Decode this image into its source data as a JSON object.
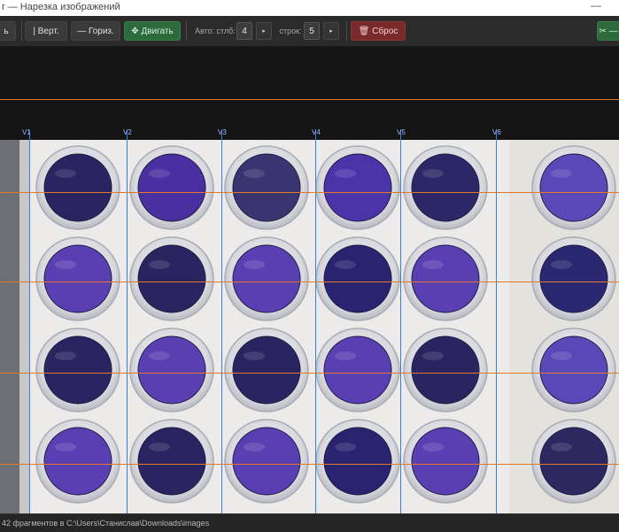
{
  "window": {
    "title": "r — Нарезка изображений",
    "minimize_glyph": "—"
  },
  "toolbar": {
    "left_cut": "ь",
    "vert_label": "| Верт.",
    "horiz_label": "— Гориз.",
    "move_label": "✥ Двигать",
    "auto_label": "Авто:",
    "cols_label": "стлб:",
    "cols_value": "4",
    "rows_label": "строк:",
    "rows_value": "5",
    "arrow_glyph": "▸",
    "reset_label": "🗑 Сброс",
    "cut_label": "✂ —"
  },
  "canvas": {
    "vertical_guides": [
      "V1",
      "V2",
      "V3",
      "V4",
      "V5",
      "V6"
    ],
    "guide_colors": {
      "vertical": "#3f78e0",
      "horizontal": "#e07a2a"
    },
    "dish_colors": {
      "row1": [
        "#2a2460",
        "#4a2fa0",
        "#3a3570",
        "#4b34a8",
        "#2c2868",
        "#5a48b8"
      ],
      "row2": [
        "#5a3fb2",
        "#2a2460",
        "#5a3fb2",
        "#2a2470",
        "#5a3fb2",
        "#2a2870"
      ],
      "row3": [
        "#2a2460",
        "#5a3fb2",
        "#2a2460",
        "#5a3fb2",
        "#2a2460",
        "#5a48b8"
      ],
      "row4": [
        "#5a3fb2",
        "#2a2460",
        "#5a3fb2",
        "#2a2470",
        "#5a3fb2",
        "#2d2860"
      ]
    }
  },
  "status": {
    "text": "42 фрагментов в C:\\Users\\Станислав\\Downloads\\images"
  }
}
